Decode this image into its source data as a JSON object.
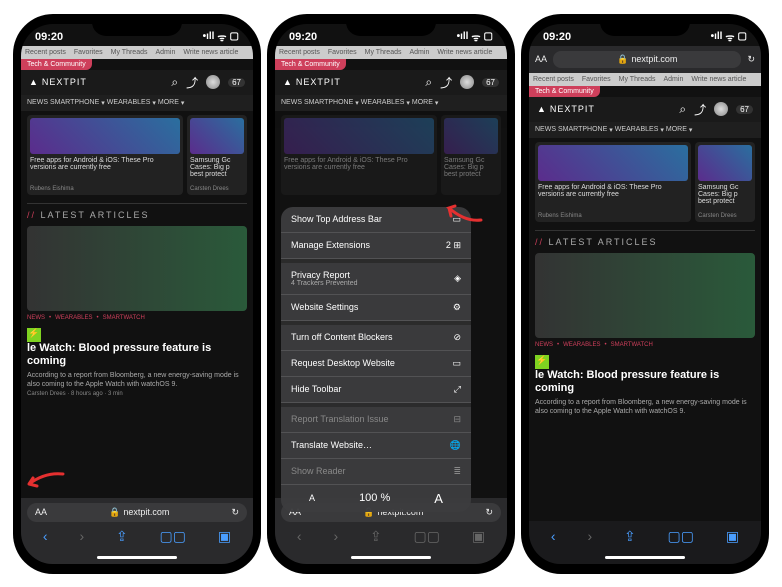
{
  "status": {
    "time": "09:20",
    "loc_icon": "➤",
    "signal": "•ıll",
    "wifi": "ᯤ",
    "battery": "▢"
  },
  "tabs": [
    "Recent posts",
    "Favorites",
    "My Threads",
    "Admin",
    "Write news article"
  ],
  "ribbon": "Tech & Community",
  "brand": "NEXTPIT",
  "search_icon": "⌕",
  "share_icon": "⤴",
  "notif_count": "67",
  "nav": [
    {
      "label": "NEWS"
    },
    {
      "label": "SMARTPHONE",
      "chev": "▾"
    },
    {
      "label": "WEARABLES",
      "chev": "▾"
    },
    {
      "label": "MORE",
      "chev": "▾"
    }
  ],
  "card1": {
    "title": "Free apps for Android & iOS: These Pro versions are currently free",
    "author": "Rubens Eishima"
  },
  "card2": {
    "title": "Samsung Gc Cases: Big p best protect",
    "author": "Carsten Drees"
  },
  "section": "LATEST ARTICLES",
  "crumbs": [
    "NEWS",
    "WEARABLES",
    "SMARTWATCH"
  ],
  "flash": "⚡",
  "headline": "le Watch: Blood pressure feature is coming",
  "headline_full": "Apple Watch: Blood pressure feature is coming",
  "desc": "According to a report from Bloomberg, a new energy-saving mode is also coming to the Apple Watch with watchOS 9.",
  "meta": "Carsten Drees · 8 hours ago · 3 min",
  "addr": {
    "aa": "AA",
    "lock": "🔒",
    "url": "nextpit.com",
    "reload": "↻"
  },
  "toolbar": {
    "back": "‹",
    "fwd": "›",
    "share": "⇪",
    "book": "▢▢",
    "tabs": "▣"
  },
  "menu": {
    "show_top": "Show Top Address Bar",
    "manage_ext": "Manage Extensions",
    "ext_count": "2",
    "privacy": "Privacy Report",
    "privacy_sub": "4 Trackers Prevented",
    "website_settings": "Website Settings",
    "cblock": "Turn off Content Blockers",
    "desktop": "Request Desktop Website",
    "hide_tb": "Hide Toolbar",
    "report_trans": "Report Translation Issue",
    "translate": "Translate Website…",
    "show_reader": "Show Reader",
    "zoom_minus": "A",
    "zoom_pct": "100 %",
    "zoom_plus": "A"
  },
  "icons": {
    "dock": "▭",
    "puzzle": "⊞",
    "shield": "◈",
    "gear": "⚙",
    "noblock": "⊘",
    "desktop": "▭",
    "arrows": "⤢",
    "chat": "⊟",
    "globe": "🌐",
    "reader": "≣"
  }
}
